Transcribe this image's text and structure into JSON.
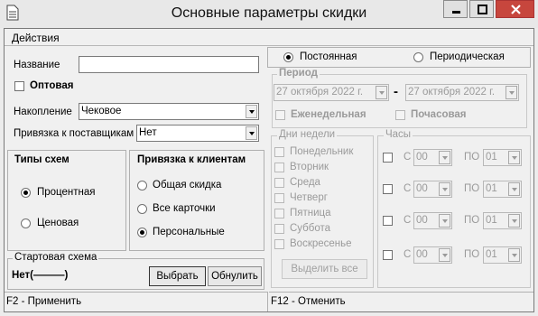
{
  "window": {
    "title": "Основные параметры скидки"
  },
  "menu": {
    "actions": "Действия"
  },
  "form": {
    "name_label": "Название",
    "name_value": "",
    "wholesale_label": "Оптовая",
    "accumulation_label": "Накопление",
    "accumulation_value": "Чековое",
    "supplier_label": "Привязка к поставщикам",
    "supplier_value": "Нет"
  },
  "scheme_types": {
    "title": "Типы схем",
    "percent": "Процентная",
    "price": "Ценовая",
    "selected": "Процентная"
  },
  "client_binding": {
    "title": "Привязка к клиентам",
    "general": "Общая скидка",
    "all_cards": "Все карточки",
    "personal": "Персональные",
    "selected": "Персональные"
  },
  "start_scheme": {
    "title": "Стартовая схема",
    "value": "Нет(———)",
    "choose_button": "Выбрать",
    "reset_button": "Обнулить"
  },
  "mode": {
    "constant": "Постоянная",
    "periodic": "Периодическая",
    "selected": "Постоянная"
  },
  "period": {
    "title": "Период",
    "from": "27  октября  2022 г.",
    "dash": "-",
    "to": "27  октября  2022 г.",
    "weekly": "Еженедельная",
    "hourly": "Почасовая"
  },
  "weekdays": {
    "title": "Дни недели",
    "days": [
      "Понедельник",
      "Вторник",
      "Среда",
      "Четверг",
      "Пятница",
      "Суббота",
      "Воскресенье"
    ],
    "select_all": "Выделить все"
  },
  "hours": {
    "title": "Часы",
    "from_label": "С",
    "to_label": "ПО",
    "rows": [
      {
        "from": "00",
        "to": "01"
      },
      {
        "from": "00",
        "to": "01"
      },
      {
        "from": "00",
        "to": "01"
      },
      {
        "from": "00",
        "to": "01"
      }
    ]
  },
  "status": {
    "apply": "F2 - Применить",
    "cancel": "F12 - Отменить"
  },
  "colors": {
    "close_button": "#c7463d",
    "disabled_text": "#9a9a9a"
  }
}
